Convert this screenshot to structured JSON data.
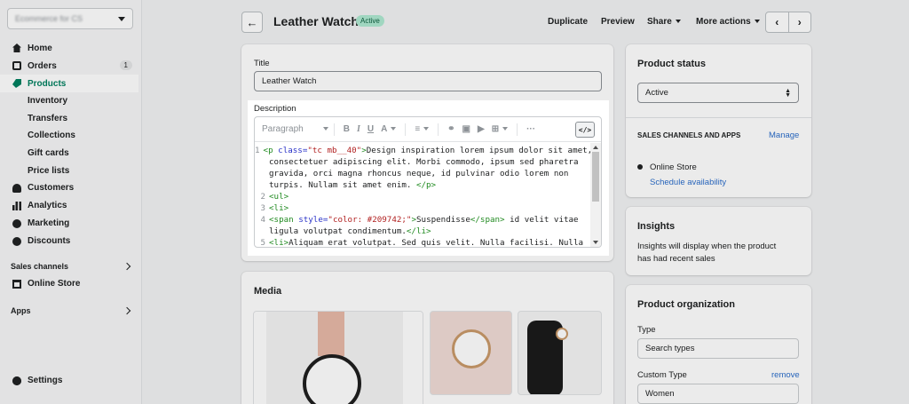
{
  "sidebar": {
    "store_name": "Ecommerce for CS",
    "items": [
      {
        "label": "Home"
      },
      {
        "label": "Orders",
        "badge": "1"
      },
      {
        "label": "Products"
      },
      {
        "label": "Inventory"
      },
      {
        "label": "Transfers"
      },
      {
        "label": "Collections"
      },
      {
        "label": "Gift cards"
      },
      {
        "label": "Price lists"
      },
      {
        "label": "Customers"
      },
      {
        "label": "Analytics"
      },
      {
        "label": "Marketing"
      },
      {
        "label": "Discounts"
      }
    ],
    "sales_channels_label": "Sales channels",
    "online_store_label": "Online Store",
    "apps_label": "Apps",
    "settings_label": "Settings"
  },
  "header": {
    "title": "Leather Watch",
    "status": "Active",
    "actions": {
      "duplicate": "Duplicate",
      "preview": "Preview",
      "share": "Share",
      "more": "More actions"
    }
  },
  "main": {
    "title_label": "Title",
    "title_value": "Leather Watch",
    "description_label": "Description",
    "toolbar": {
      "paragraph": "Paragraph"
    },
    "code_lines": [
      {
        "n": "1",
        "parts": [
          [
            "tg",
            "<p "
          ],
          [
            "at",
            "class="
          ],
          [
            "vl",
            "\"tc mb__40\""
          ],
          [
            "tg",
            ">"
          ],
          [
            "tx",
            "Design inspiration lorem ipsum dolor sit amet,"
          ]
        ]
      },
      {
        "n": "",
        "parts": [
          [
            "tx",
            "consectetuer adipiscing elit. Morbi commodo, ipsum sed pharetra"
          ]
        ]
      },
      {
        "n": "",
        "parts": [
          [
            "tx",
            "gravida, orci magna rhoncus neque, id pulvinar odio lorem non"
          ]
        ]
      },
      {
        "n": "",
        "parts": [
          [
            "tx",
            "turpis. Nullam sit amet enim. "
          ],
          [
            "tg",
            "</p>"
          ]
        ]
      },
      {
        "n": "2",
        "parts": [
          [
            "tg",
            "<ul>"
          ]
        ]
      },
      {
        "n": "3",
        "parts": [
          [
            "tg",
            "<li>"
          ]
        ]
      },
      {
        "n": "4",
        "parts": [
          [
            "tg",
            "<span "
          ],
          [
            "at",
            "style="
          ],
          [
            "vl",
            "\"color: #209742;\""
          ],
          [
            "tg",
            ">"
          ],
          [
            "tx",
            "Suspendisse"
          ],
          [
            "tg",
            "</span>"
          ],
          [
            "tx",
            " id velit vitae"
          ]
        ]
      },
      {
        "n": "",
        "parts": [
          [
            "tx",
            "ligula volutpat condimentum."
          ],
          [
            "tg",
            "</li>"
          ]
        ]
      },
      {
        "n": "5",
        "parts": [
          [
            "tg",
            "<li>"
          ],
          [
            "tx",
            "Aliquam erat volutpat. Sed quis velit. Nulla facilisi. Nulla"
          ]
        ]
      }
    ],
    "media_label": "Media"
  },
  "right": {
    "status_title": "Product status",
    "status_value": "Active",
    "channels_label": "SALES CHANNELS AND APPS",
    "manage": "Manage",
    "online_store": "Online Store",
    "schedule": "Schedule availability",
    "insights_title": "Insights",
    "insights_text_1": "Insights will display when the product",
    "insights_text_2": "has had recent sales",
    "org_title": "Product organization",
    "type_label": "Type",
    "type_placeholder": "Search types",
    "custom_type_label": "Custom Type",
    "remove": "remove",
    "custom_type_value": "Women"
  },
  "colors": {
    "brand_green": "#008060",
    "link_blue": "#2c6ecb",
    "pill_bg": "#aee9d1"
  }
}
